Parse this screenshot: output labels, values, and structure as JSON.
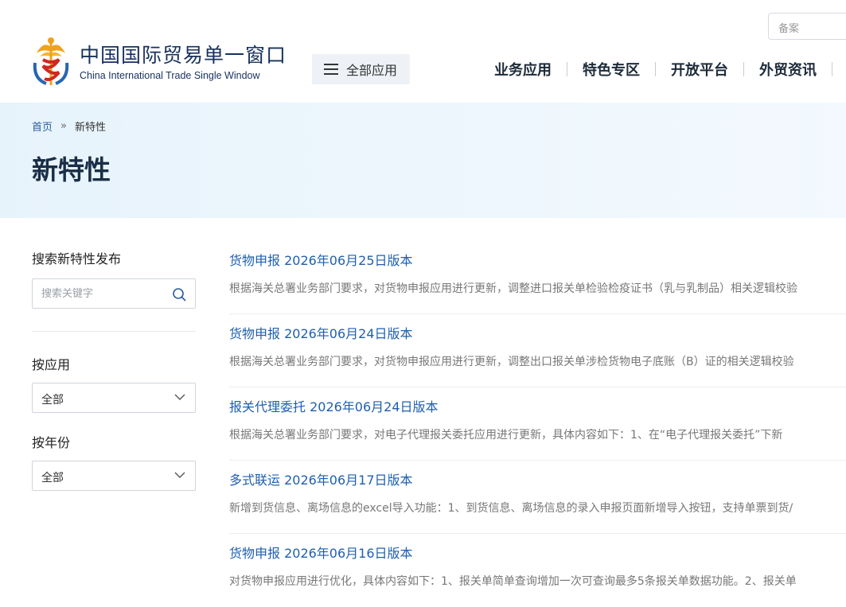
{
  "header": {
    "logo_cn": "中国国际贸易单一窗口",
    "logo_en": "China International Trade Single Window",
    "all_apps_label": "全部应用",
    "search_placeholder": "备案",
    "nav": [
      "业务应用",
      "特色专区",
      "开放平台",
      "外贸资讯"
    ]
  },
  "breadcrumb": {
    "home": "首页",
    "separator": "»",
    "current": "新特性"
  },
  "page_title": "新特性",
  "sidebar": {
    "search_heading": "搜索新特性发布",
    "search_placeholder": "搜索关键字",
    "filter_app_label": "按应用",
    "filter_app_value": "全部",
    "filter_year_label": "按年份",
    "filter_year_value": "全部"
  },
  "items": [
    {
      "title": "货物申报 2026年06月25日版本",
      "desc": "根据海关总署业务部门要求，对货物申报应用进行更新，调整进口报关单检验检疫证书（乳与乳制品）相关逻辑校验"
    },
    {
      "title": "货物申报 2026年06月24日版本",
      "desc": "根据海关总署业务部门要求，对货物申报应用进行更新，调整出口报关单涉检货物电子底账（B）证的相关逻辑校验"
    },
    {
      "title": "报关代理委托 2026年06月24日版本",
      "desc": "根据海关总署业务部门要求，对电子代理报关委托应用进行更新，具体内容如下：1、在“电子代理报关委托”下新"
    },
    {
      "title": "多式联运 2026年06月17日版本",
      "desc": "新增到货信息、离场信息的excel导入功能：1、到货信息、离场信息的录入申报页面新增导入按钮，支持单票到货/"
    },
    {
      "title": "货物申报 2026年06月16日版本",
      "desc": "对货物申报应用进行优化，具体内容如下：1、报关单简单查询增加一次可查询最多5条报关单数据功能。2、报关单"
    }
  ],
  "colors": {
    "brand_navy": "#17315c",
    "link_blue": "#1f5fae",
    "banner_bg": "#e7f3fb"
  },
  "icons": {
    "logo": "caduceus-logo-icon",
    "menu": "hamburger-menu-icon",
    "search": "search-icon",
    "dropdown": "chevron-down-icon"
  }
}
